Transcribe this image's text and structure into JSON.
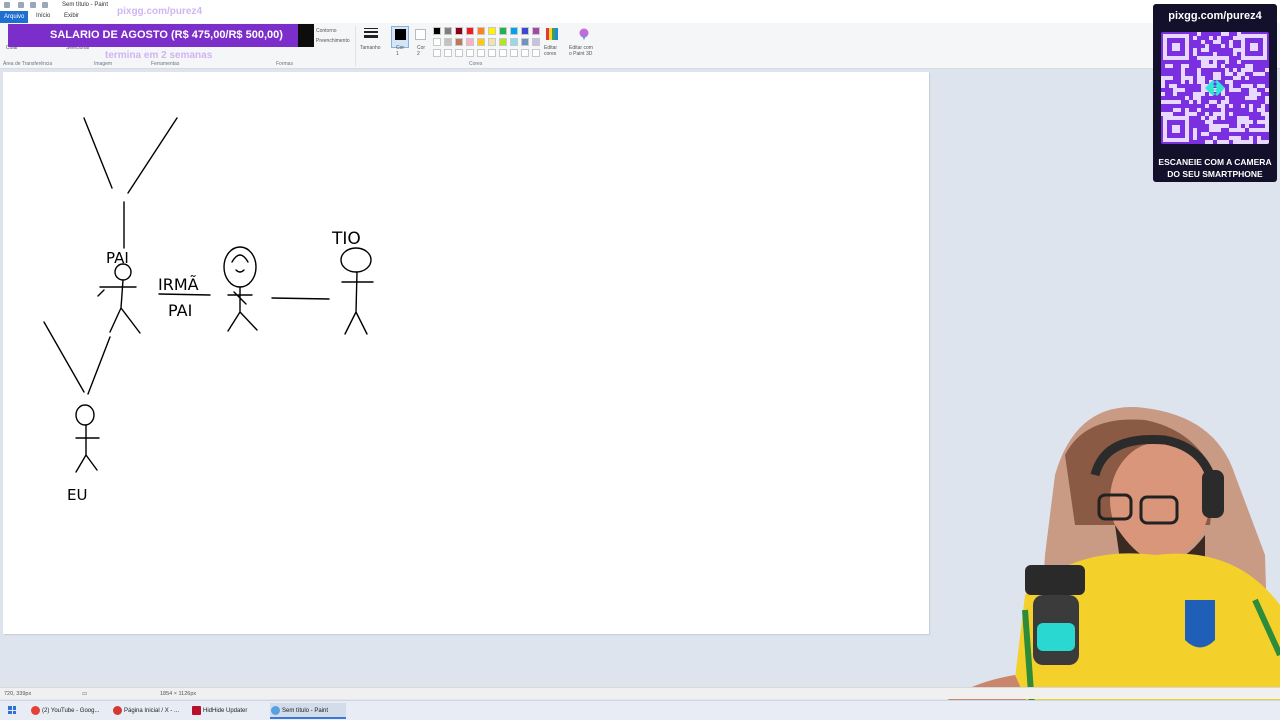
{
  "app": {
    "window_title": "Sem título - Paint",
    "menu_tabs": [
      "Arquivo",
      "Início",
      "Exibir"
    ]
  },
  "ribbon": {
    "groups": [
      "Área de Transferência",
      "Imagem",
      "Ferramentas",
      "Formas",
      "Cores"
    ],
    "clipboard_label": "Colar",
    "select_label": "Selecionar",
    "outline_label": "Contorno",
    "fill_label": "Preenchimento",
    "size_label": "Tamanho",
    "color1_label": "Cor\n1",
    "color2_label": "Cor\n2",
    "edit_colors_label": "Editar\ncores",
    "paint3d_label": "Editar com\no Paint 3D",
    "palette": [
      "#000000",
      "#7f7f7f",
      "#880015",
      "#ed1c24",
      "#ff7f27",
      "#fff200",
      "#22b14c",
      "#00a2e8",
      "#3f48cc",
      "#a349a4",
      "#ffffff",
      "#c3c3c3",
      "#b97a57",
      "#ffaec9",
      "#ffc90e",
      "#efe4b0",
      "#b5e61d",
      "#99d9ea",
      "#7092be",
      "#c8bfe7"
    ]
  },
  "overlays": {
    "banner_text": "SALARIO DE AGOSTO (R$ 475,00/R$ 500,00)",
    "banner_sub": "termina em 2 semanas",
    "ghost_url": "pixgg.com/purez4",
    "qr_url": "pixgg.com/purez4",
    "qr_caption": "ESCANEIE COM A CAMERA DO SEU SMARTPHONE"
  },
  "drawing_labels": {
    "pai": "PAI",
    "irma": "IRMÃ",
    "pai2": "PAI",
    "tio": "TIO",
    "eu": "EU"
  },
  "statusbar": {
    "cursor_pos": "720, 339px",
    "canvas_size": "1854 × 1126px"
  },
  "taskbar": {
    "items": [
      "(2) YouTube - Goog...",
      "Página Inicial / X - ...",
      "HidHide Updater",
      "Sem título - Paint"
    ]
  }
}
